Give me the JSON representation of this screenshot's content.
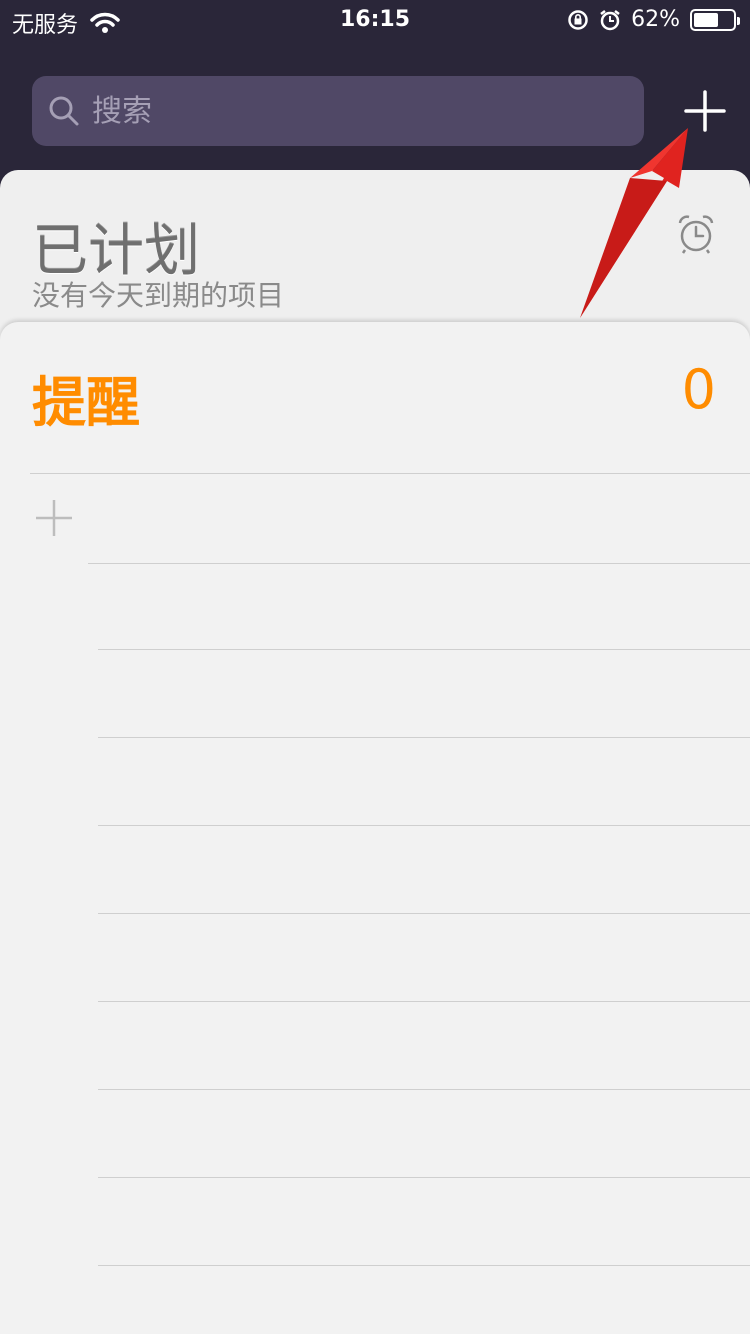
{
  "status": {
    "carrier": "无服务",
    "time": "16:15",
    "battery_percent": "62%",
    "battery_level": 0.62
  },
  "search": {
    "placeholder": "搜索"
  },
  "scheduled": {
    "title": "已计划",
    "subtitle": "没有今天到期的项目"
  },
  "reminders": {
    "title": "提醒",
    "count": "0"
  },
  "icons": [
    "wifi-icon",
    "rotation-lock-icon",
    "alarm-icon",
    "battery-icon",
    "search-icon",
    "plus-icon",
    "alarm-clock-icon",
    "plus-icon"
  ],
  "colors": {
    "accent": "#ff8c00",
    "annotation": "#e0231f"
  }
}
